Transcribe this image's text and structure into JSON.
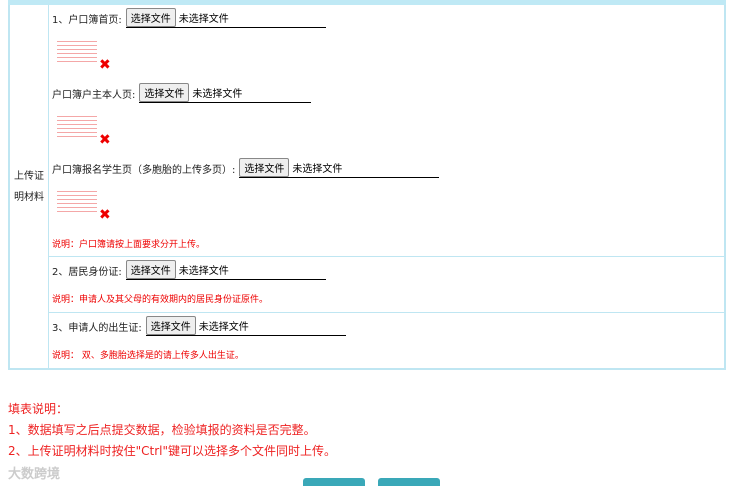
{
  "section_label": "上传证明材料",
  "file_button": "选择文件",
  "no_file": "未选择文件",
  "fields": [
    {
      "label": "1、户口簿首页:"
    },
    {
      "label": "户口簿户主本人页:"
    },
    {
      "label": "户口簿报名学生页（多胞胎的上传多页）:"
    },
    {
      "label": "2、居民身份证:"
    },
    {
      "label": "3、申请人的出生证:"
    }
  ],
  "notes": [
    "说明：户口簿请按上面要求分开上传。",
    "说明：申请人及其父母的有效期内的居民身份证原件。",
    "说明： 双、多胞胎选择是的请上传多人出生证。"
  ],
  "instructions": {
    "title": "填表说明：",
    "items": [
      "1、数据填写之后点提交数据，检验填报的资料是否完整。",
      "2、上传证明材料时按住\"Ctrl\"键可以选择多个文件同时上传。"
    ]
  },
  "watermark": "大数跨境"
}
